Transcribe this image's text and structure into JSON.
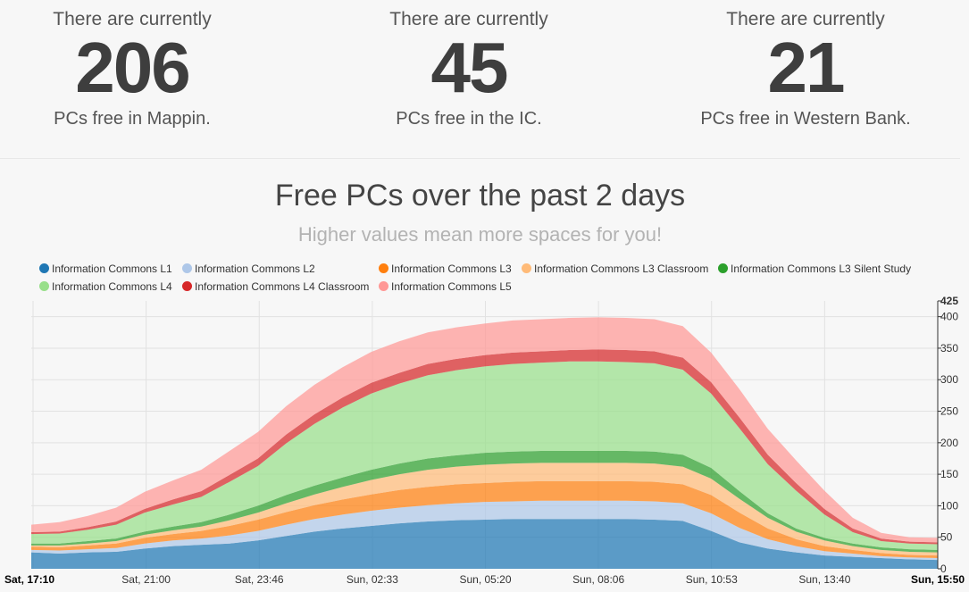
{
  "stats": [
    {
      "pre": "There are currently",
      "value": "206",
      "post": "PCs free in Mappin."
    },
    {
      "pre": "There are currently",
      "value": "45",
      "post": "PCs free in the IC."
    },
    {
      "pre": "There are currently",
      "value": "21",
      "post": "PCs free in Western Bank."
    }
  ],
  "chart": {
    "title": "Free PCs over the past 2 days",
    "subtitle": "Higher values mean more spaces for you!"
  },
  "chart_data": {
    "type": "area",
    "stacked": true,
    "title": "Free PCs over the past 2 days",
    "subtitle": "Higher values mean more spaces for you!",
    "x_tick_labels": [
      "Sat, 17:10",
      "Sat, 21:00",
      "Sat, 23:46",
      "Sun, 02:33",
      "Sun, 05:20",
      "Sun, 08:06",
      "Sun, 10:53",
      "Sun, 13:40",
      "Sun, 15:50"
    ],
    "x_tick_bold": [
      true,
      false,
      false,
      false,
      false,
      false,
      false,
      false,
      true
    ],
    "y_ticks": [
      0,
      50,
      100,
      150,
      200,
      250,
      300,
      350,
      400,
      425
    ],
    "ylim": [
      0,
      425
    ],
    "grid": true,
    "legend_position": "top",
    "x": [
      "17:10",
      "17:53",
      "18:36",
      "19:20",
      "20:03",
      "20:46",
      "21:30",
      "22:13",
      "22:56",
      "23:40",
      "00:23",
      "01:06",
      "01:50",
      "02:33",
      "03:16",
      "04:00",
      "04:43",
      "05:26",
      "06:10",
      "06:53",
      "07:36",
      "08:20",
      "09:03",
      "09:46",
      "10:30",
      "11:13",
      "11:56",
      "12:40",
      "13:23",
      "14:06",
      "14:50",
      "15:33",
      "15:50"
    ],
    "series": [
      {
        "name": "Information Commons L1",
        "color": "#1f77b4",
        "values": [
          26,
          24,
          26,
          27,
          32,
          36,
          38,
          40,
          45,
          52,
          59,
          64,
          68,
          72,
          75,
          77,
          78,
          79,
          79,
          79,
          79,
          79,
          78,
          76,
          60,
          42,
          32,
          26,
          21,
          19,
          17,
          15,
          14
        ]
      },
      {
        "name": "Information Commons L2",
        "color": "#aec7e8",
        "values": [
          4,
          5,
          5,
          6,
          8,
          9,
          10,
          13,
          15,
          18,
          20,
          22,
          24,
          25,
          26,
          27,
          28,
          28,
          29,
          29,
          29,
          29,
          29,
          28,
          28,
          23,
          15,
          10,
          7,
          5,
          3,
          3,
          3
        ]
      },
      {
        "name": "Information Commons L3",
        "color": "#ff7f0e",
        "values": [
          5,
          5,
          6,
          7,
          9,
          10,
          12,
          15,
          18,
          20,
          22,
          24,
          26,
          28,
          29,
          30,
          30,
          31,
          31,
          31,
          31,
          31,
          31,
          30,
          29,
          24,
          17,
          11,
          8,
          6,
          5,
          4,
          4
        ]
      },
      {
        "name": "Information Commons L3 Classroom",
        "color": "#ffbb78",
        "values": [
          2,
          3,
          3,
          4,
          5,
          6,
          7,
          9,
          11,
          14,
          17,
          20,
          23,
          25,
          27,
          28,
          29,
          29,
          29,
          29,
          29,
          29,
          29,
          28,
          26,
          22,
          17,
          12,
          9,
          6,
          5,
          5,
          5
        ]
      },
      {
        "name": "Information Commons L3 Silent Study",
        "color": "#2ca02c",
        "values": [
          3,
          3,
          4,
          4,
          5,
          6,
          7,
          9,
          11,
          13,
          14,
          15,
          16,
          17,
          18,
          18,
          19,
          19,
          19,
          19,
          19,
          19,
          19,
          19,
          17,
          12,
          7,
          5,
          4,
          4,
          4,
          4,
          4
        ]
      },
      {
        "name": "Information Commons L4",
        "color": "#98df8a",
        "values": [
          15,
          16,
          18,
          22,
          30,
          35,
          40,
          52,
          63,
          82,
          98,
          111,
          121,
          127,
          132,
          135,
          137,
          139,
          140,
          142,
          142,
          141,
          140,
          135,
          118,
          100,
          78,
          60,
          37,
          18,
          10,
          9,
          9
        ]
      },
      {
        "name": "Information Commons L4 Classroom",
        "color": "#d62728",
        "values": [
          3,
          3,
          4,
          5,
          6,
          8,
          9,
          11,
          12,
          14,
          15,
          16,
          17,
          17,
          18,
          18,
          18,
          18,
          18,
          18,
          19,
          19,
          19,
          19,
          18,
          17,
          15,
          12,
          9,
          6,
          4,
          3,
          3
        ]
      },
      {
        "name": "Information Commons L5",
        "color": "#ff9896",
        "values": [
          12,
          15,
          18,
          22,
          27,
          30,
          34,
          38,
          42,
          45,
          47,
          48,
          49,
          50,
          50,
          50,
          50,
          51,
          51,
          51,
          51,
          51,
          51,
          50,
          47,
          45,
          41,
          36,
          29,
          17,
          9,
          7,
          7
        ]
      }
    ]
  }
}
